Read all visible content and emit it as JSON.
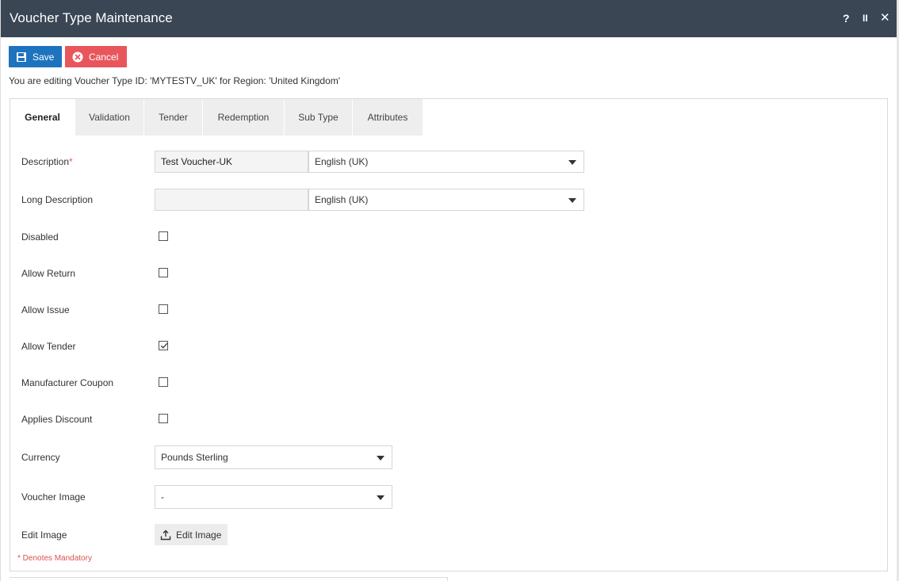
{
  "window": {
    "title": "Voucher Type Maintenance",
    "help_label": "?",
    "pause_label": "II",
    "close_label": "✕"
  },
  "toolbar": {
    "save_label": "Save",
    "cancel_label": "Cancel"
  },
  "info_text": "You are editing Voucher Type ID: 'MYTESTV_UK' for Region: 'United Kingdom'",
  "tabs": [
    {
      "label": "General",
      "active": true
    },
    {
      "label": "Validation",
      "active": false
    },
    {
      "label": "Tender",
      "active": false
    },
    {
      "label": "Redemption",
      "active": false
    },
    {
      "label": "Sub Type",
      "active": false
    },
    {
      "label": "Attributes",
      "active": false
    }
  ],
  "form": {
    "description": {
      "label": "Description",
      "required_mark": "*",
      "value": "Test Voucher-UK",
      "language": "English (UK)"
    },
    "long_description": {
      "label": "Long Description",
      "value": "",
      "language": "English (UK)"
    },
    "disabled": {
      "label": "Disabled",
      "checked": false
    },
    "allow_return": {
      "label": "Allow Return",
      "checked": false
    },
    "allow_issue": {
      "label": "Allow Issue",
      "checked": false
    },
    "allow_tender": {
      "label": "Allow Tender",
      "checked": true
    },
    "manufacturer_coupon": {
      "label": "Manufacturer Coupon",
      "checked": false
    },
    "applies_discount": {
      "label": "Applies Discount",
      "checked": false
    },
    "currency": {
      "label": "Currency",
      "value": "Pounds Sterling"
    },
    "voucher_image": {
      "label": "Voucher Image",
      "value": "-"
    },
    "edit_image": {
      "label": "Edit Image",
      "button_label": "Edit Image"
    }
  },
  "mandatory_note": "* Denotes Mandatory",
  "colors": {
    "titlebar": "#3a4654",
    "save_button": "#1e73be",
    "cancel_button": "#e8565b",
    "required": "#e8565b"
  },
  "icons": {
    "save": "floppy-disk-icon",
    "cancel": "x-circle-icon",
    "edit_image": "upload-icon",
    "dropdown": "caret-down-icon",
    "check": "checkmark-icon"
  }
}
